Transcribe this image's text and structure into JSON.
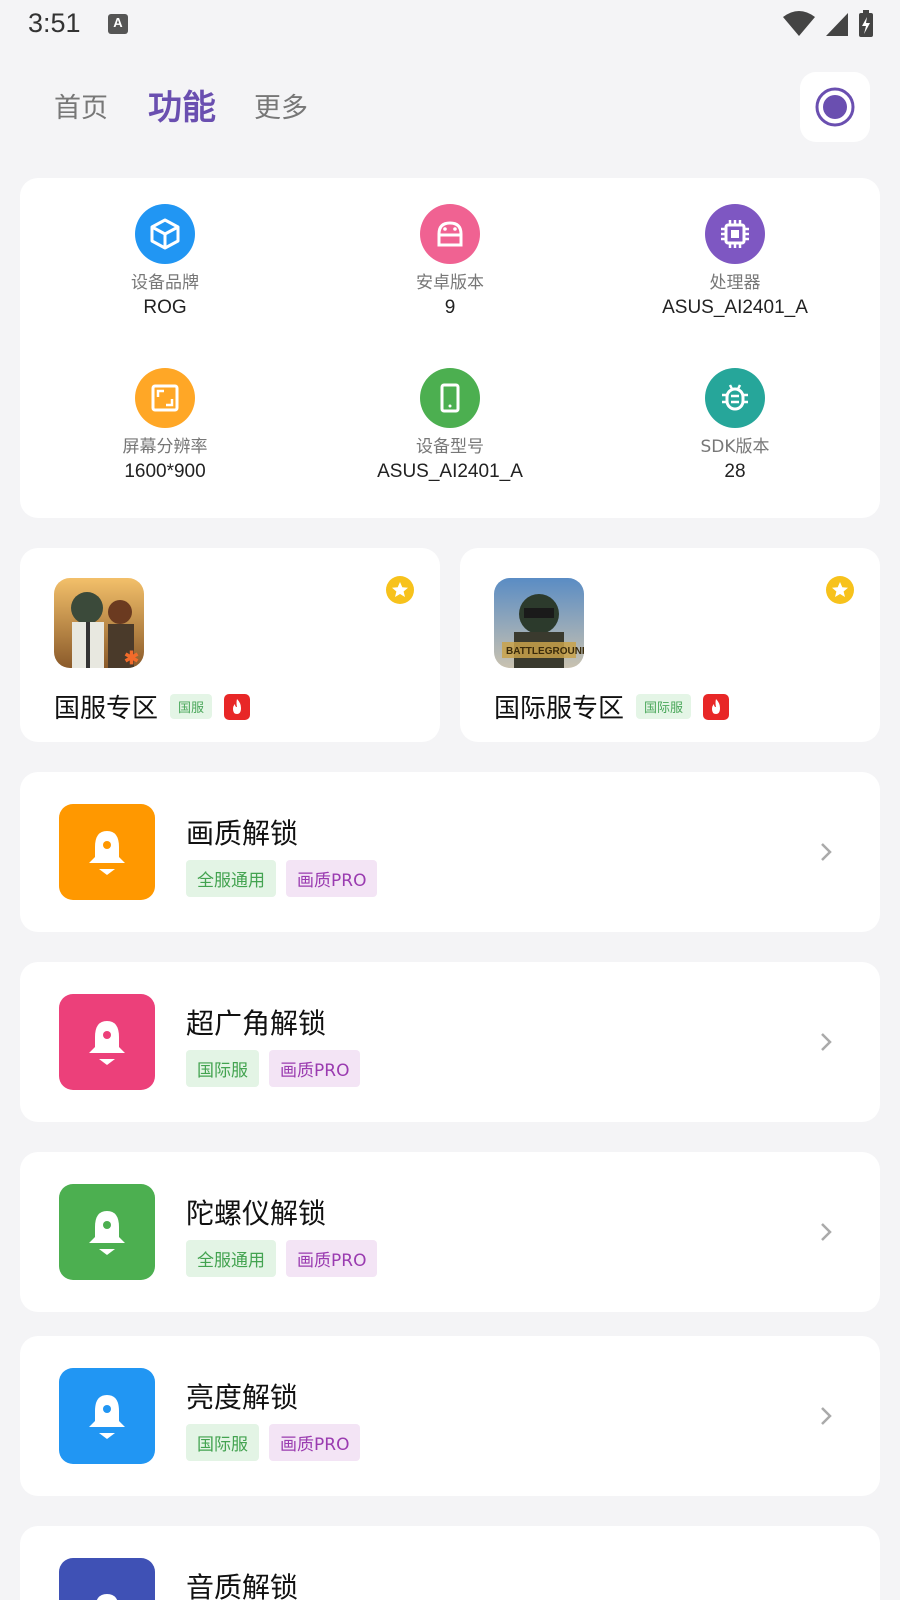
{
  "status": {
    "time": "3:51"
  },
  "nav": {
    "tabs": [
      "首页",
      "功能",
      "更多"
    ],
    "active": "功能"
  },
  "device_info": [
    {
      "label": "设备品牌",
      "value": "ROG",
      "icon": "cube-icon",
      "color": "#2196f3"
    },
    {
      "label": "安卓版本",
      "value": "9",
      "icon": "android-icon",
      "color": "#f06292"
    },
    {
      "label": "处理器",
      "value": "ASUS_AI2401_A",
      "icon": "chip-icon",
      "color": "#7e57c2"
    },
    {
      "label": "屏幕分辨率",
      "value": "1600*900",
      "icon": "screen-frame-icon",
      "color": "#ffa726"
    },
    {
      "label": "设备型号",
      "value": "ASUS_AI2401_A",
      "icon": "phone-icon",
      "color": "#4caf50"
    },
    {
      "label": "SDK版本",
      "value": "28",
      "icon": "bug-icon",
      "color": "#26a69a"
    }
  ],
  "zones": [
    {
      "title": "国服专区",
      "tag": "国服"
    },
    {
      "title": "国际服专区",
      "tag": "国际服"
    }
  ],
  "functions": [
    {
      "title": "画质解锁",
      "tags": [
        "全服通用",
        "画质PRO"
      ],
      "color": "#ff9800"
    },
    {
      "title": "超广角解锁",
      "tags": [
        "国际服",
        "画质PRO"
      ],
      "color": "#ec407a"
    },
    {
      "title": "陀螺仪解锁",
      "tags": [
        "全服通用",
        "画质PRO"
      ],
      "color": "#4caf50"
    },
    {
      "title": "亮度解锁",
      "tags": [
        "国际服",
        "画质PRO"
      ],
      "color": "#2196f3"
    },
    {
      "title": "音质解锁",
      "tags": [],
      "color": "#3f51b5"
    }
  ]
}
